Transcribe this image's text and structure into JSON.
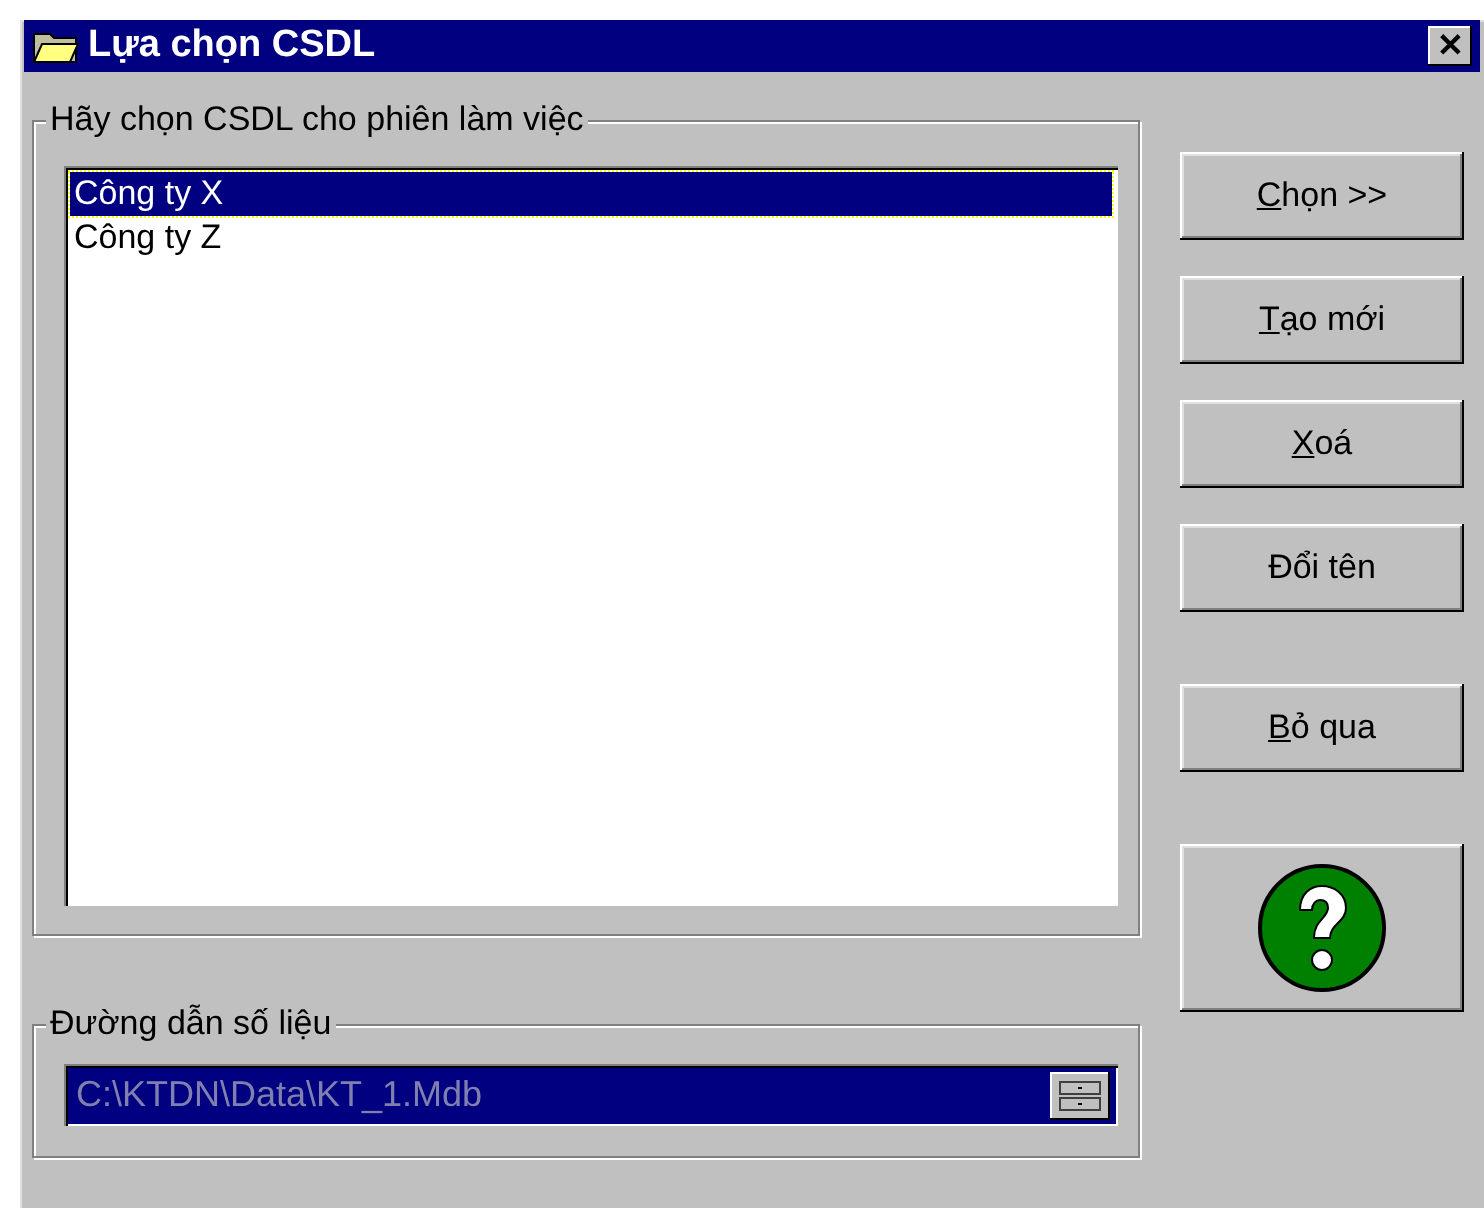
{
  "window": {
    "title": "Lựa chọn CSDL",
    "close": "✕"
  },
  "database_group": {
    "label": "Hãy chọn CSDL cho phiên làm việc",
    "items": [
      {
        "label": "Công ty X",
        "selected": true
      },
      {
        "label": "Công ty Z",
        "selected": false
      }
    ]
  },
  "buttons": [
    {
      "kind": "text",
      "key": "C",
      "rest": "họn >>"
    },
    {
      "kind": "text",
      "key": "T",
      "rest": "ạo mới"
    },
    {
      "kind": "text",
      "key": "X",
      "rest": "oá"
    },
    {
      "kind": "text",
      "rest": "Đổi tên"
    },
    {
      "kind": "text",
      "key": "B",
      "rest": "ỏ qua"
    },
    {
      "kind": "help"
    }
  ],
  "path_group": {
    "label": "Đường dẫn số liệu",
    "value": "C:\\KTDN\\Data\\KT_1.Mdb"
  }
}
